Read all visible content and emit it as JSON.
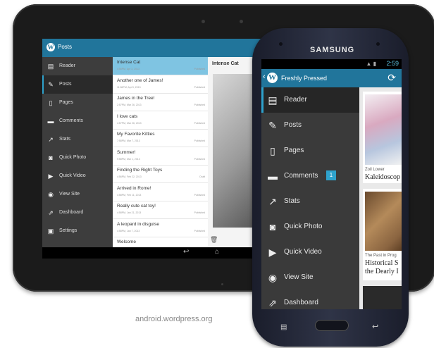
{
  "tablet": {
    "header_title": "Posts",
    "menu": [
      {
        "label": "Reader",
        "icon": "reader-icon"
      },
      {
        "label": "Posts",
        "icon": "pin-icon"
      },
      {
        "label": "Pages",
        "icon": "pages-icon"
      },
      {
        "label": "Comments",
        "icon": "comment-icon"
      },
      {
        "label": "Stats",
        "icon": "stats-icon"
      },
      {
        "label": "Quick Photo",
        "icon": "camera-icon"
      },
      {
        "label": "Quick Video",
        "icon": "video-icon"
      },
      {
        "label": "View Site",
        "icon": "eye-icon"
      },
      {
        "label": "Dashboard",
        "icon": "dashboard-icon"
      },
      {
        "label": "Settings",
        "icon": "settings-icon"
      }
    ],
    "posts": [
      {
        "title": "Intense Cat",
        "date": "4:56PM, Apr 3, 2013",
        "status": "Published"
      },
      {
        "title": "Another one of James!",
        "date": "11:56PM, Apr 5, 2013",
        "status": "Published"
      },
      {
        "title": "James in the Tree!",
        "date": "2:57PM, Mar 26, 2013",
        "status": "Published"
      },
      {
        "title": "I love cats",
        "date": "4:57PM, Mar 26, 2013",
        "status": "Published"
      },
      {
        "title": "My Favorite Kitties",
        "date": "7:58PM, Mar 7, 2013",
        "status": "Published"
      },
      {
        "title": "Summer!",
        "date": "9:58PM, Mar 1, 2013",
        "status": "Published"
      },
      {
        "title": "Finding the Right Toys",
        "date": "4:56PM, Feb 22, 2013",
        "status": "Draft"
      },
      {
        "title": "Arrived in Rome!",
        "date": "4:58PM, Feb 11, 2013",
        "status": "Published"
      },
      {
        "title": "Really cute cat toy!",
        "date": "4:58PM, Jan 21, 2013",
        "status": "Published"
      },
      {
        "title": "A leopard in disguise",
        "date": "4:58PM, Jan 7, 2013",
        "status": "Published"
      },
      {
        "title": "Welcome",
        "date": "",
        "status": ""
      }
    ],
    "detail_title": "Intense Cat"
  },
  "phone": {
    "brand": "SAMSUNG",
    "status_time": "2:59",
    "header_title": "Freshly Pressed",
    "menu": [
      {
        "label": "Reader",
        "icon": "reader-icon"
      },
      {
        "label": "Posts",
        "icon": "pin-icon"
      },
      {
        "label": "Pages",
        "icon": "pages-icon"
      },
      {
        "label": "Comments",
        "icon": "comment-icon",
        "badge": "1"
      },
      {
        "label": "Stats",
        "icon": "stats-icon"
      },
      {
        "label": "Quick Photo",
        "icon": "camera-icon"
      },
      {
        "label": "Quick Video",
        "icon": "video-icon"
      },
      {
        "label": "View Site",
        "icon": "eye-icon"
      },
      {
        "label": "Dashboard",
        "icon": "dashboard-icon"
      }
    ],
    "cards": [
      {
        "caption": "Zoil Lower",
        "title": "Kaleidoscop"
      },
      {
        "caption": "The Past in Prog",
        "title": "Historical S",
        "title2": "the Dearly I"
      }
    ]
  },
  "site_url": "android.wordpress.org"
}
